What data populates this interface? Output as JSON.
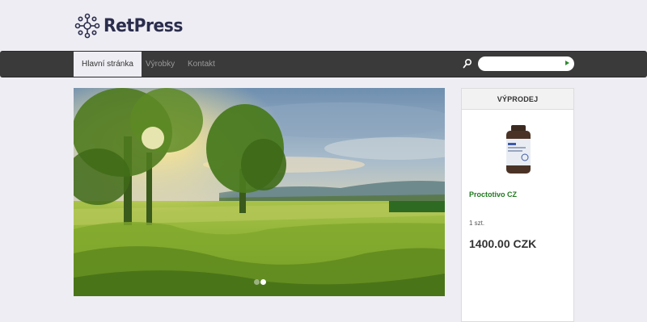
{
  "brand": {
    "name": "RetPress"
  },
  "nav": {
    "items": [
      {
        "label": "Hlavní stránka",
        "active": true
      },
      {
        "label": "Výrobky",
        "active": false
      },
      {
        "label": "Kontakt",
        "active": false
      }
    ],
    "search": {
      "placeholder": "",
      "value": ""
    }
  },
  "slider": {
    "image": "meadow-sunset-landscape",
    "active_dot": 2,
    "dot_count": 2
  },
  "sidebar": {
    "title": "VÝPRODEJ",
    "product": {
      "name": "Proctotivo CZ",
      "quantity": "1 szt.",
      "price": "1400.00 CZK",
      "bottle_label": "PROCTOTIVO"
    }
  },
  "colors": {
    "navbar": "#3a3a3a",
    "background": "#eeedf3",
    "brand": "#2b2d4d",
    "product_link": "#1f7a1f"
  }
}
